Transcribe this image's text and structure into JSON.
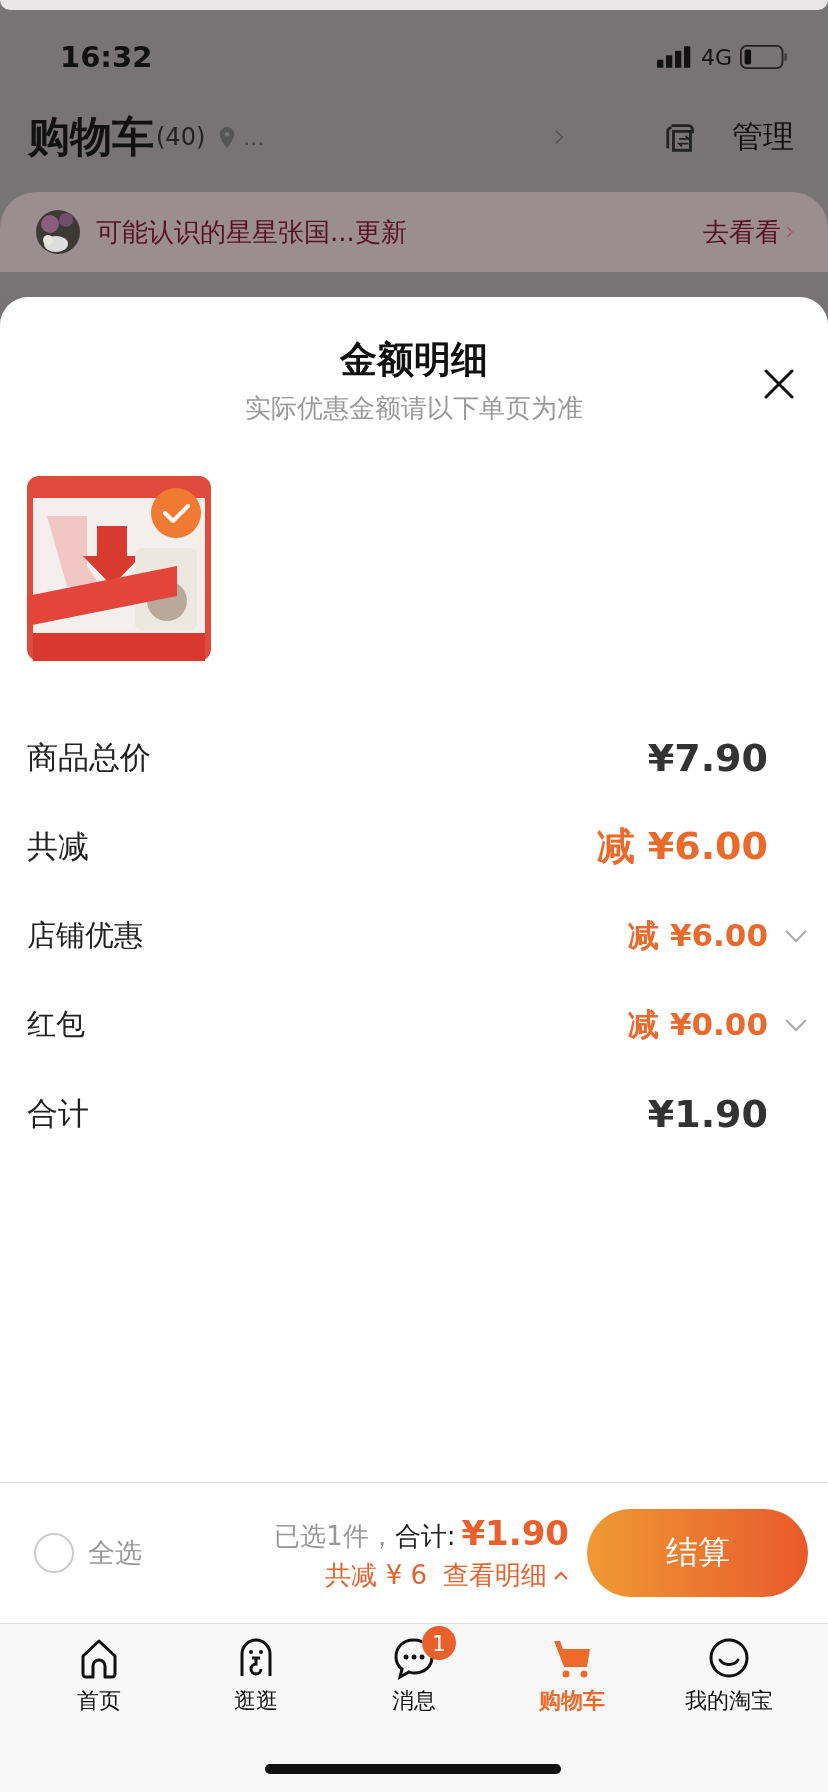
{
  "status_bar": {
    "time": "16:32",
    "network": "4G"
  },
  "header": {
    "title": "购物车",
    "count": "(40)",
    "location": "...",
    "manage": "管理"
  },
  "notice": {
    "text": "可能认识的星星张国...更新",
    "action": "去看看"
  },
  "sheet": {
    "title": "金额明细",
    "subtitle": "实际优惠金额请以下单页为准",
    "product": {
      "kind": "picture",
      "selected": true
    },
    "rows": [
      {
        "label": "商品总价",
        "value": "¥7.90",
        "kind": "major",
        "color": "#333333"
      },
      {
        "label": "共减",
        "value": "减 ¥6.00",
        "kind": "major",
        "color": "#ea6a2c"
      },
      {
        "label": "店铺优惠",
        "value": "减 ¥6.00",
        "kind": "detail",
        "color": "#ea6a2c",
        "expanded": false
      },
      {
        "label": "红包",
        "value": "减 ¥0.00",
        "kind": "detail",
        "color": "#ea6a2c",
        "expanded": false
      },
      {
        "label": "合计",
        "value": "¥1.90",
        "kind": "major",
        "color": "#333333"
      }
    ]
  },
  "bottom_bar": {
    "select_all": {
      "label": "全选",
      "checked": false
    },
    "selected_count": "已选1件，",
    "total_label": "合计:",
    "total": "¥1.90",
    "discount": "共减 ¥ 6",
    "details_link": "查看明细",
    "checkout": "结算"
  },
  "tab_bar": [
    {
      "label": "首页",
      "selected": false
    },
    {
      "label": "逛逛",
      "selected": false
    },
    {
      "label": "消息",
      "selected": false,
      "badge": "1"
    },
    {
      "label": "购物车",
      "selected": true
    },
    {
      "label": "我的淘宝",
      "selected": false
    }
  ]
}
